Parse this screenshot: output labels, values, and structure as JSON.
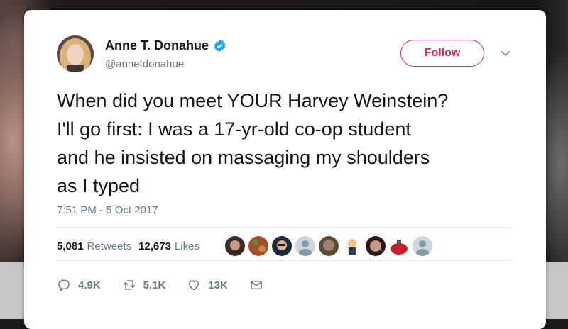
{
  "author": {
    "name": "Anne T. Donahue",
    "handle": "@annetdonahue",
    "verified_icon": "verified-badge-icon"
  },
  "header": {
    "follow_label": "Follow",
    "menu_icon": "chevron-down-icon"
  },
  "tweet": {
    "text": "When did you meet YOUR Harvey Weinstein?\nI'll go first: I was a 17-yr-old co-op student\nand he insisted on massaging my shoulders\nas I typed",
    "timestamp": "7:51 PM - 5 Oct 2017"
  },
  "stats": {
    "retweets_count": "5,081",
    "retweets_label": "Retweets",
    "likes_count": "12,673",
    "likes_label": "Likes"
  },
  "actions": {
    "reply_count": "4.9K",
    "retweet_count": "5.1K",
    "like_count": "13K"
  },
  "colors": {
    "accent": "#e0245e",
    "verified": "#1da1f2",
    "muted": "#657786",
    "text": "#14171a"
  }
}
